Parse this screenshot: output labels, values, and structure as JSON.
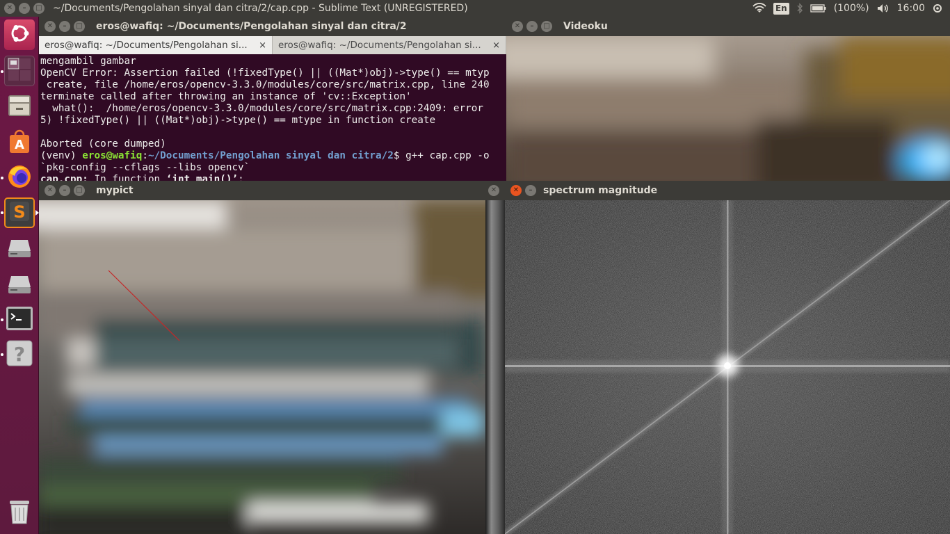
{
  "top_panel": {
    "title": "~/Documents/Pengolahan sinyal dan citra/2/cap.cpp - Sublime Text (UNREGISTERED)",
    "language": "En",
    "battery": "(100%)",
    "clock": "16:00"
  },
  "launcher": {
    "items": [
      {
        "name": "dash-home",
        "icon": "ubuntu-logo-icon"
      },
      {
        "name": "workspace-switcher",
        "icon": "workspace-icon"
      },
      {
        "name": "files",
        "icon": "file-cabinet-icon"
      },
      {
        "name": "software-center",
        "icon": "shopping-bag-icon"
      },
      {
        "name": "firefox",
        "icon": "firefox-icon"
      },
      {
        "name": "sublime-text",
        "icon": "sublime-icon"
      },
      {
        "name": "drive-1",
        "icon": "hard-drive-icon"
      },
      {
        "name": "drive-2",
        "icon": "hard-drive-icon"
      },
      {
        "name": "terminal",
        "icon": "terminal-icon"
      },
      {
        "name": "help",
        "icon": "help-icon"
      },
      {
        "name": "trash",
        "icon": "trash-icon"
      }
    ]
  },
  "terminal": {
    "title": "eros@wafiq: ~/Documents/Pengolahan sinyal dan citra/2",
    "tabs": [
      {
        "label": "eros@wafiq: ~/Documents/Pengolahan si...",
        "close": "×"
      },
      {
        "label": "eros@wafiq: ~/Documents/Pengolahan si...",
        "close": "×"
      }
    ],
    "lines": {
      "l1": "mengambil gambar",
      "l2": "OpenCV Error: Assertion failed (!fixedType() || ((Mat*)obj)->type() == mtyp",
      "l3": " create, file /home/eros/opencv-3.3.0/modules/core/src/matrix.cpp, line 240",
      "l4": "terminate called after throwing an instance of 'cv::Exception'",
      "l5": "  what():  /home/eros/opencv-3.3.0/modules/core/src/matrix.cpp:2409: error",
      "l6": "5) !fixedType() || ((Mat*)obj)->type() == mtype in function create",
      "l7": "",
      "l8": "Aborted (core dumped)",
      "l9_venv": "(venv) ",
      "l9_user": "eros@wafiq",
      "l9_colon": ":",
      "l9_path": "~/Documents/Pengolahan sinyal dan citra/2",
      "l9_cmd": "$ g++ cap.cpp -o",
      "l10": "`pkg-config --cflags --libs opencv`",
      "l11_file": "cap.cpp:",
      "l11_rest": " In function ",
      "l11_fn": "‘int main()’",
      "l11_end": ":"
    }
  },
  "videoku": {
    "title": "Videoku"
  },
  "mypict": {
    "title": "mypict"
  },
  "spectrum": {
    "title": "spectrum magnitude"
  }
}
